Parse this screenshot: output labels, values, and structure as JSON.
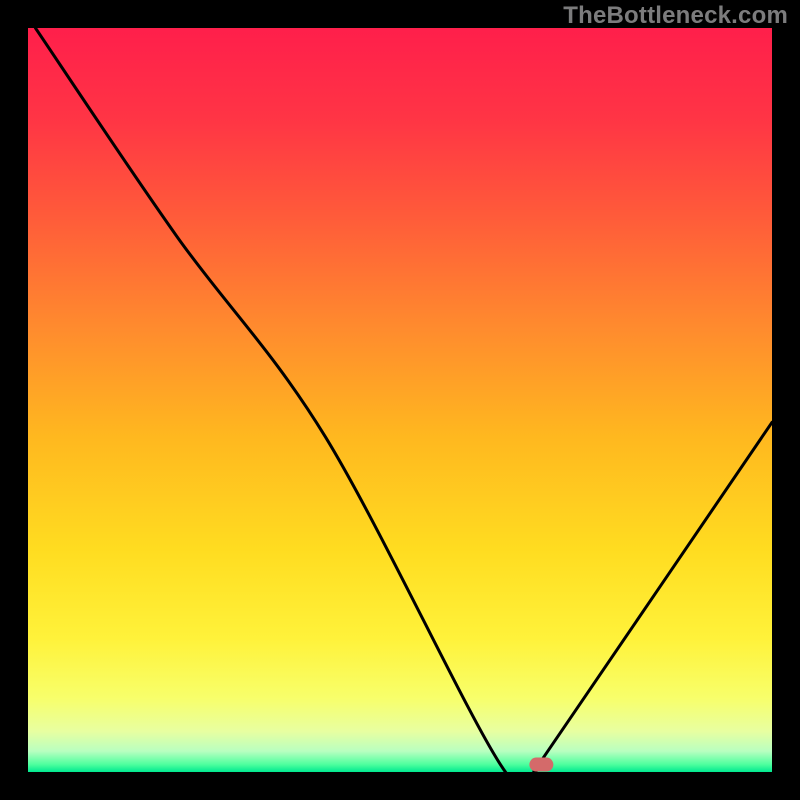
{
  "brand": "TheBottleneck.com",
  "chart_data": {
    "type": "line",
    "title": "",
    "xlabel": "",
    "ylabel": "",
    "xlim": [
      0,
      100
    ],
    "ylim": [
      0,
      100
    ],
    "grid": false,
    "series": [
      {
        "name": "curve",
        "x": [
          1,
          20,
          40,
          63.5,
          68.5,
          70,
          100
        ],
        "values": [
          100,
          72,
          45,
          1,
          1,
          3,
          47
        ]
      }
    ],
    "marker": {
      "x": 69,
      "y": 1,
      "color": "#d46a6a"
    },
    "gradient_stops": [
      {
        "offset": 0.0,
        "color": "#ff1f4b"
      },
      {
        "offset": 0.12,
        "color": "#ff3445"
      },
      {
        "offset": 0.25,
        "color": "#ff5a3a"
      },
      {
        "offset": 0.4,
        "color": "#ff8a2e"
      },
      {
        "offset": 0.55,
        "color": "#ffb81f"
      },
      {
        "offset": 0.7,
        "color": "#ffdc20"
      },
      {
        "offset": 0.82,
        "color": "#fff23a"
      },
      {
        "offset": 0.9,
        "color": "#f8ff6a"
      },
      {
        "offset": 0.945,
        "color": "#e8ffa0"
      },
      {
        "offset": 0.972,
        "color": "#b9ffc0"
      },
      {
        "offset": 0.99,
        "color": "#4dff9e"
      },
      {
        "offset": 1.0,
        "color": "#00e890"
      }
    ]
  }
}
